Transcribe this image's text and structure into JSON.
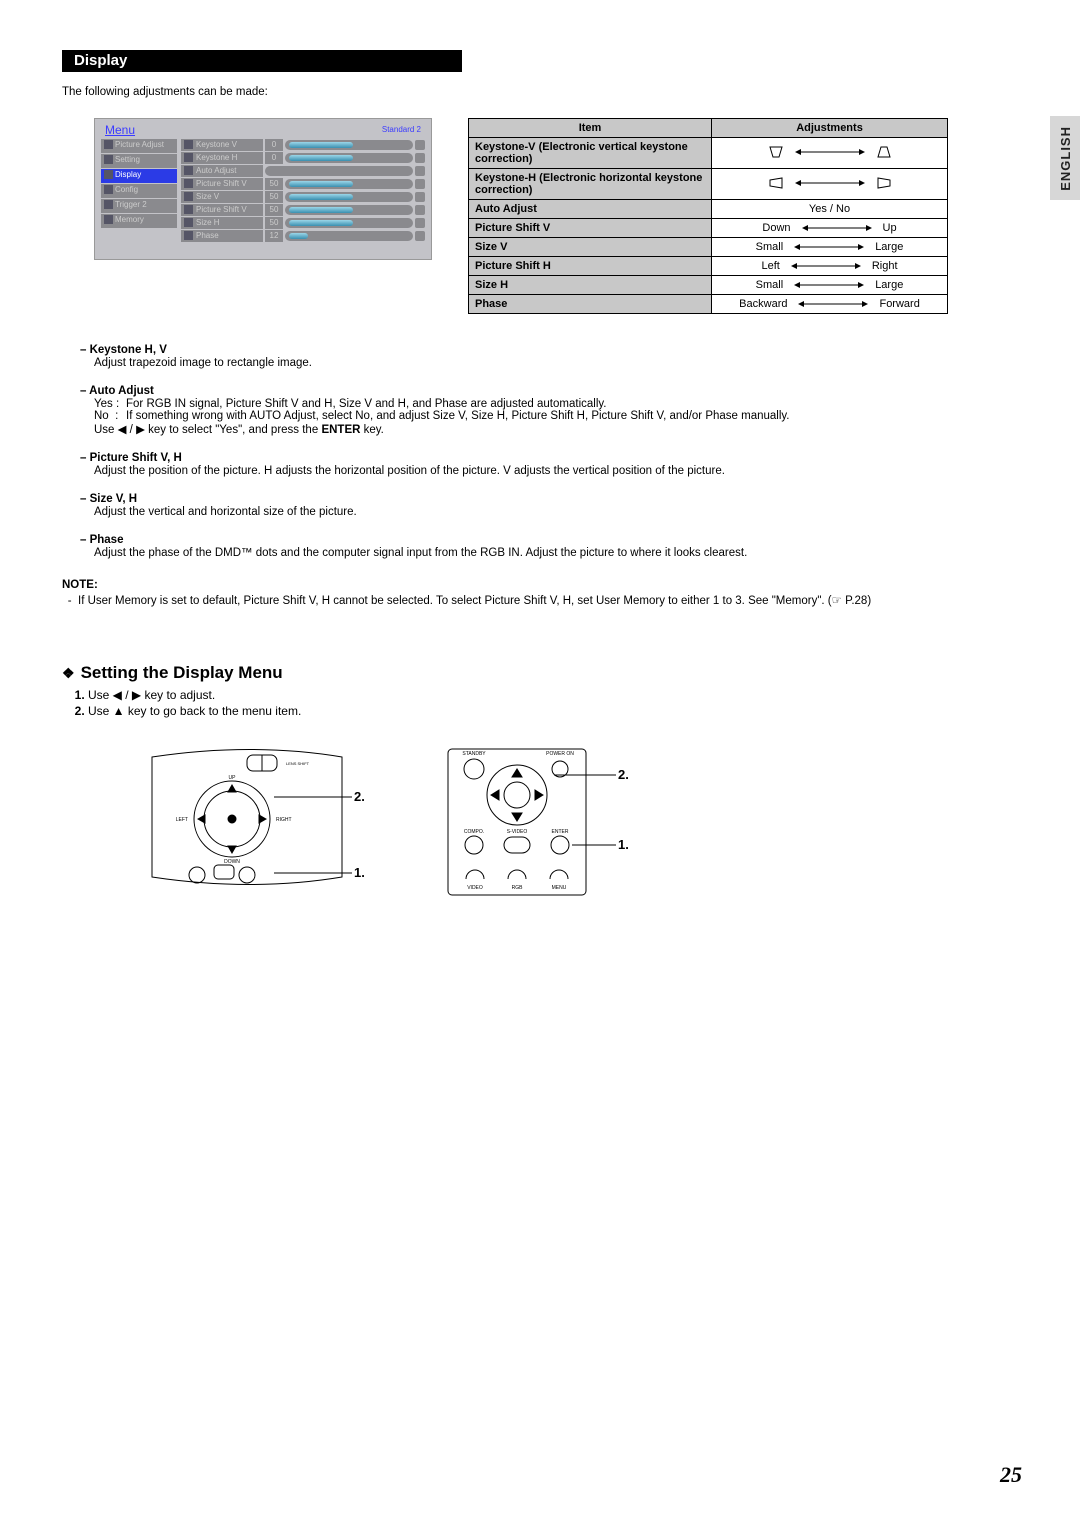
{
  "sideTab": "ENGLISH",
  "pageTitle": "Display",
  "intro": "The following adjustments can be made:",
  "menu": {
    "title": "Menu",
    "mode": "Standard 2",
    "left": [
      "Picture Adjust",
      "Setting",
      "Display",
      "Config",
      "Trigger 2",
      "Memory"
    ],
    "selectedIndex": 2,
    "right": [
      {
        "label": "Keystone V",
        "val": "0",
        "fill": 50
      },
      {
        "label": "Keystone H",
        "val": "0",
        "fill": 50
      },
      {
        "label": "Auto Adjust",
        "val": "",
        "fill": 0
      },
      {
        "label": "Picture Shift V",
        "val": "50",
        "fill": 50
      },
      {
        "label": "Size V",
        "val": "50",
        "fill": 50
      },
      {
        "label": "Picture Shift V",
        "val": "50",
        "fill": 50
      },
      {
        "label": "Size H",
        "val": "50",
        "fill": 50
      },
      {
        "label": "Phase",
        "val": "12",
        "fill": 15
      }
    ]
  },
  "adjTable": {
    "headers": [
      "Item",
      "Adjustments"
    ],
    "rows": [
      {
        "item": "Keystone-V (Electronic vertical keystone correction)",
        "type": "trapV"
      },
      {
        "item": "Keystone-H (Electronic horizontal keystone correction)",
        "type": "trapH"
      },
      {
        "item": "Auto Adjust",
        "type": "text",
        "text": "Yes / No"
      },
      {
        "item": "Picture Shift V",
        "type": "range",
        "left": "Down",
        "right": "Up"
      },
      {
        "item": "Size V",
        "type": "range",
        "left": "Small",
        "right": "Large"
      },
      {
        "item": "Picture Shift H",
        "type": "range",
        "left": "Left",
        "right": "Right"
      },
      {
        "item": "Size H",
        "type": "range",
        "left": "Small",
        "right": "Large"
      },
      {
        "item": "Phase",
        "type": "range",
        "left": "Backward",
        "right": "Forward"
      }
    ]
  },
  "defs": [
    {
      "title": "– Keystone H, V",
      "lines": [
        "Adjust trapezoid image to rectangle image."
      ]
    },
    {
      "title": "– Auto Adjust",
      "yesno": {
        "yes": "For RGB IN signal, Picture Shift V and H, Size V and H, and Phase are adjusted automatically.",
        "no": "If something wrong with AUTO Adjust, select No, and adjust Size V, Size H, Picture Shift H, Picture Shift V, and/or Phase manually."
      },
      "tail": "Use ◀ / ▶ key to select \"Yes\", and press the ENTER key."
    },
    {
      "title": "– Picture Shift V, H",
      "lines": [
        "Adjust the position of the picture. H adjusts the horizontal position of the picture. V adjusts the vertical position of the picture."
      ]
    },
    {
      "title": "– Size V, H",
      "lines": [
        "Adjust the vertical and horizontal size of the picture."
      ]
    },
    {
      "title": "– Phase",
      "lines": [
        "Adjust the phase of the DMD™ dots and the computer signal input from the RGB IN. Adjust the picture to where it looks clearest."
      ]
    }
  ],
  "note": {
    "title": "NOTE:",
    "items": [
      "If User Memory is set to default, Picture Shift V, H cannot be selected. To select Picture Shift V, H, set User Memory to either 1 to 3. See \"Memory\". (☞ P.28)"
    ]
  },
  "subheading": "Setting the Display Menu",
  "steps": [
    "Use ◀ / ▶ key to adjust.",
    "Use ▲ key to go back to the menu item."
  ],
  "pageNumber": "25",
  "remoteLabels": {
    "standby": "STANDBY",
    "poweron": "POWER ON",
    "compo": "COMPO.",
    "svideo": "S-VIDEO",
    "enter": "ENTER",
    "video": "VIDEO",
    "rgb": "RGB",
    "menu": "MENU"
  },
  "topPanelLabels": {
    "up": "UP",
    "down": "DOWN",
    "left": "LEFT",
    "right": "RIGHT",
    "lens": "LENS SHIFT"
  }
}
